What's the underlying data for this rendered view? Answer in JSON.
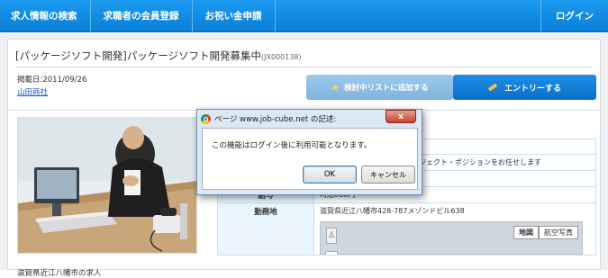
{
  "nav": {
    "items": [
      {
        "label": "求人情報の検索"
      },
      {
        "label": "求職者の会員登録"
      },
      {
        "label": "お祝い金申請"
      }
    ],
    "login": "ログイン"
  },
  "job": {
    "title": "[パッケージソフト開発]パッケージソフト開発募集中",
    "code": "(JX000138)",
    "date": "掲載日:2011/09/26",
    "company": "山田商社",
    "watch_button": "検討中リストに追加する",
    "entry_button": "エントリーする",
    "photo_caption": "滋賀県近江八幡市の求人"
  },
  "table": {
    "rows": [
      {
        "header": "",
        "value": ""
      },
      {
        "header": "",
        "value": "ジェクト・ポジションをお任せします"
      },
      {
        "header": "",
        "value": ""
      },
      {
        "header": "給与",
        "value": "時給888円"
      },
      {
        "header": "勤務地",
        "value": "滋賀県近江八幡市428-787メゾンドビル638"
      }
    ],
    "map_btn_map": "地図",
    "map_btn_photo": "航空写真",
    "zoom_in": "+"
  },
  "dialog": {
    "title": "ページ www.job-cube.net の記述:",
    "close": "x",
    "message": "この機能はログイン後に利用可能となります。",
    "ok": "OK",
    "cancel": "キャンセル"
  },
  "colors": {
    "nav": "#0b7fd6",
    "entry": "#0a6fc7",
    "watch": "#7fb4de"
  }
}
